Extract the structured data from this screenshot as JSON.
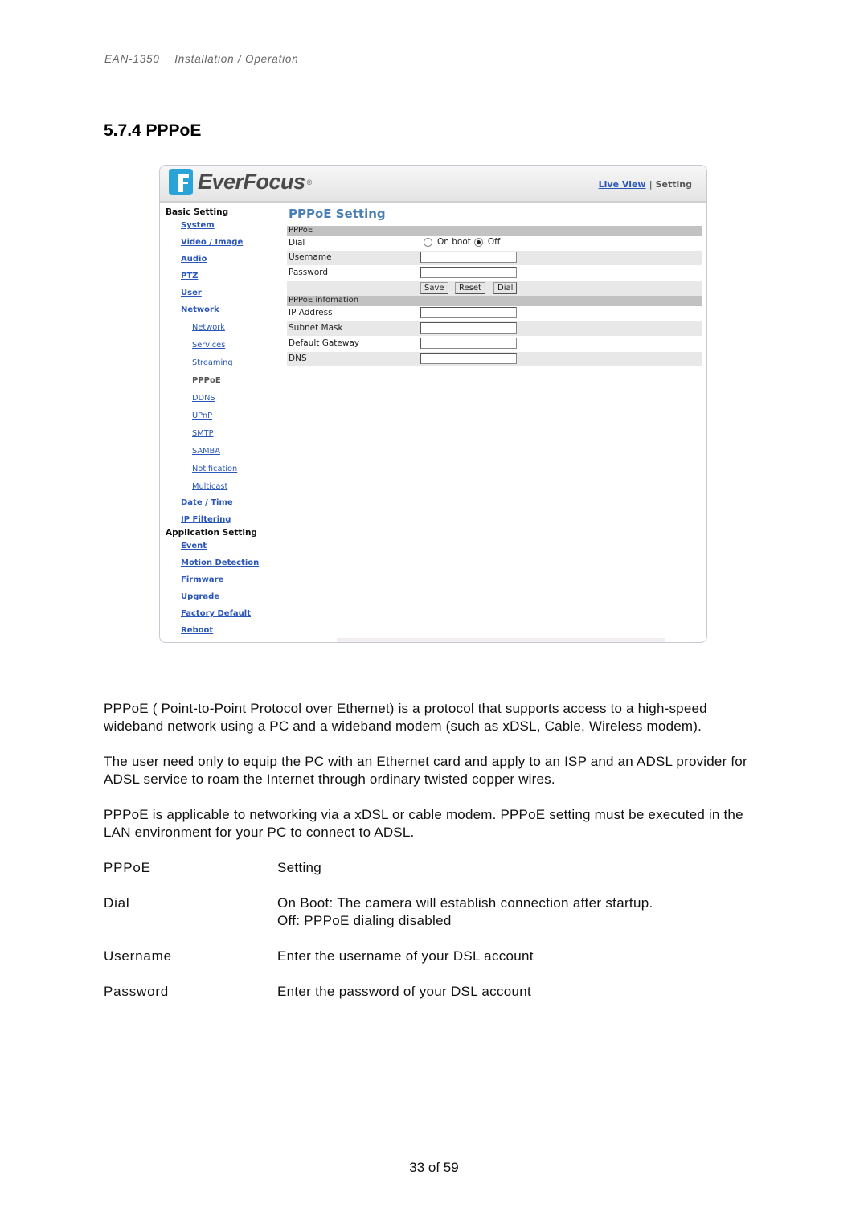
{
  "header": {
    "doc_id": "EAN-1350",
    "doc_title": "Installation / Operation"
  },
  "section": {
    "title": "5.7.4 PPPoE"
  },
  "app": {
    "brand": "EverFocus",
    "brand_reg": "®",
    "brand_color": "#2aa3d6",
    "top_nav": {
      "live_view": "Live View",
      "separator": "|",
      "setting": "Setting"
    },
    "sidebar": {
      "basic_group": "Basic Setting",
      "basic_items": [
        "System",
        "Video / Image",
        "Audio",
        "PTZ",
        "User",
        "Network"
      ],
      "network_subitems": [
        "Network",
        "Services",
        "Streaming",
        "PPPoE",
        "DDNS",
        "UPnP",
        "SMTP",
        "SAMBA",
        "Notification",
        "Multicast"
      ],
      "active_subitem": "PPPoE",
      "basic_items_after": [
        "Date / Time",
        "IP Filtering"
      ],
      "application_group": "Application Setting",
      "application_items": [
        "Event",
        "Motion Detection",
        "Firmware",
        "Upgrade",
        "Factory Default",
        "Reboot"
      ]
    },
    "page_heading": "PPPoE Setting",
    "pppoe_section": {
      "header": "PPPoE",
      "dial_label": "Dial",
      "dial_options": [
        "On boot",
        "Off"
      ],
      "dial_selected": "Off",
      "username_label": "Username",
      "username_value": "",
      "password_label": "Password",
      "password_value": "",
      "buttons": {
        "save": "Save",
        "reset": "Reset",
        "dial": "Dial"
      }
    },
    "info_section": {
      "header": "PPPoE infomation",
      "fields": [
        {
          "label": "IP Address",
          "value": ""
        },
        {
          "label": "Subnet Mask",
          "value": ""
        },
        {
          "label": "Default Gateway",
          "value": ""
        },
        {
          "label": "DNS",
          "value": ""
        }
      ]
    }
  },
  "body": {
    "paragraphs": [
      "PPPoE ( Point-to-Point Protocol over Ethernet) is a protocol that supports access to a high-speed wideband network using a PC and a wideband modem (such as xDSL, Cable, Wireless modem).",
      "The user need only to equip the PC with an Ethernet card and apply to an ISP and an ADSL provider for ADSL service to roam the Internet through ordinary twisted copper wires.",
      "PPPoE is applicable to networking via a xDSL or cable modem. PPPoE setting must be executed in the LAN environment for your PC to connect to ADSL."
    ],
    "definitions": [
      {
        "term": "PPPoE",
        "desc": [
          "Setting"
        ]
      },
      {
        "term": "Dial",
        "desc": [
          "On Boot: The camera will establish connection after startup.",
          "Off: PPPoE dialing disabled"
        ]
      },
      {
        "term": "Username",
        "desc": [
          "Enter the username of your DSL account"
        ]
      },
      {
        "term": "Password",
        "desc": [
          "Enter the password of your DSL account"
        ]
      }
    ]
  },
  "footer": {
    "page_label": "33 of 59"
  }
}
